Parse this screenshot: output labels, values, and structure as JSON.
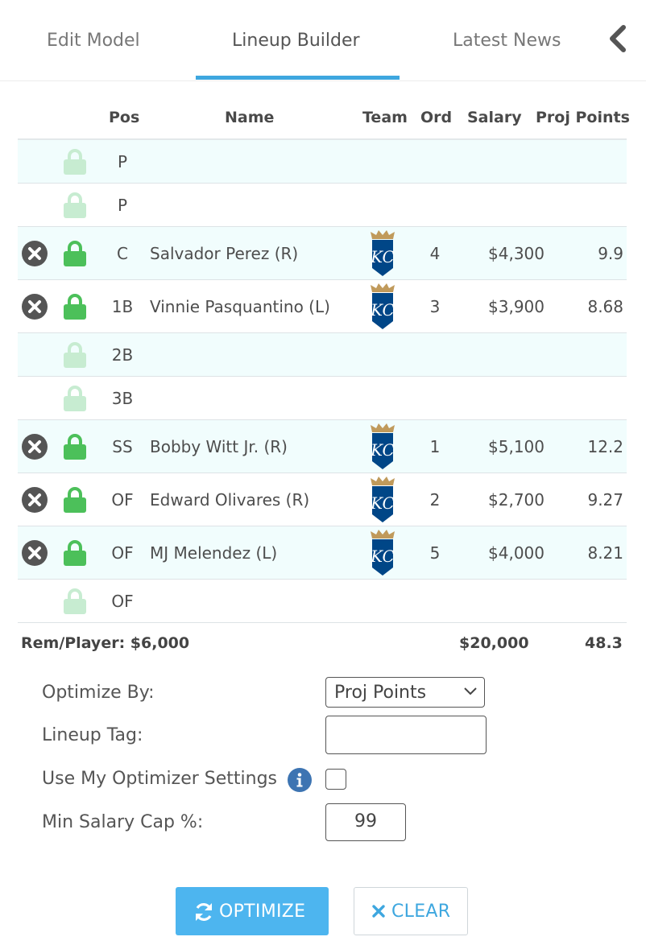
{
  "tabs": [
    {
      "label": "Edit Model",
      "active": false
    },
    {
      "label": "Lineup Builder",
      "active": true
    },
    {
      "label": "Latest News",
      "active": false
    }
  ],
  "colors": {
    "accent": "#3ea7df",
    "lock_active": "#4cc05a",
    "lock_inactive": "#c7ecd1",
    "row_alt": "#f1fdfd",
    "team_logo": "#004687"
  },
  "table": {
    "headers": {
      "pos": "Pos",
      "name": "Name",
      "team": "Team",
      "ord": "Ord",
      "salary": "Salary",
      "proj": "Proj Points"
    },
    "rows": [
      {
        "pos": "P",
        "name": "",
        "team": "",
        "ord": "",
        "salary": "",
        "proj": "",
        "filled": false,
        "locked": false
      },
      {
        "pos": "P",
        "name": "",
        "team": "",
        "ord": "",
        "salary": "",
        "proj": "",
        "filled": false,
        "locked": false
      },
      {
        "pos": "C",
        "name": "Salvador Perez (R)",
        "team": "KC",
        "ord": "4",
        "salary": "$4,300",
        "proj": "9.9",
        "filled": true,
        "locked": true
      },
      {
        "pos": "1B",
        "name": "Vinnie Pasquantino (L)",
        "team": "KC",
        "ord": "3",
        "salary": "$3,900",
        "proj": "8.68",
        "filled": true,
        "locked": true
      },
      {
        "pos": "2B",
        "name": "",
        "team": "",
        "ord": "",
        "salary": "",
        "proj": "",
        "filled": false,
        "locked": false
      },
      {
        "pos": "3B",
        "name": "",
        "team": "",
        "ord": "",
        "salary": "",
        "proj": "",
        "filled": false,
        "locked": false
      },
      {
        "pos": "SS",
        "name": "Bobby Witt Jr. (R)",
        "team": "KC",
        "ord": "1",
        "salary": "$5,100",
        "proj": "12.2",
        "filled": true,
        "locked": true
      },
      {
        "pos": "OF",
        "name": "Edward Olivares (R)",
        "team": "KC",
        "ord": "2",
        "salary": "$2,700",
        "proj": "9.27",
        "filled": true,
        "locked": true
      },
      {
        "pos": "OF",
        "name": "MJ Melendez (L)",
        "team": "KC",
        "ord": "5",
        "salary": "$4,000",
        "proj": "8.21",
        "filled": true,
        "locked": true
      },
      {
        "pos": "OF",
        "name": "",
        "team": "",
        "ord": "",
        "salary": "",
        "proj": "",
        "filled": false,
        "locked": false
      }
    ]
  },
  "totals": {
    "rem_player": "Rem/Player: $6,000",
    "salary": "$20,000",
    "points": "48.3"
  },
  "form": {
    "optimize_by_label": "Optimize By:",
    "optimize_by_value": "Proj Points",
    "lineup_tag_label": "Lineup Tag:",
    "lineup_tag_value": "",
    "use_settings_label": "Use My Optimizer Settings",
    "use_settings_checked": false,
    "min_salary_label": "Min Salary Cap %:",
    "min_salary_value": "99"
  },
  "buttons": {
    "optimize": "OPTIMIZE",
    "clear": "CLEAR"
  }
}
